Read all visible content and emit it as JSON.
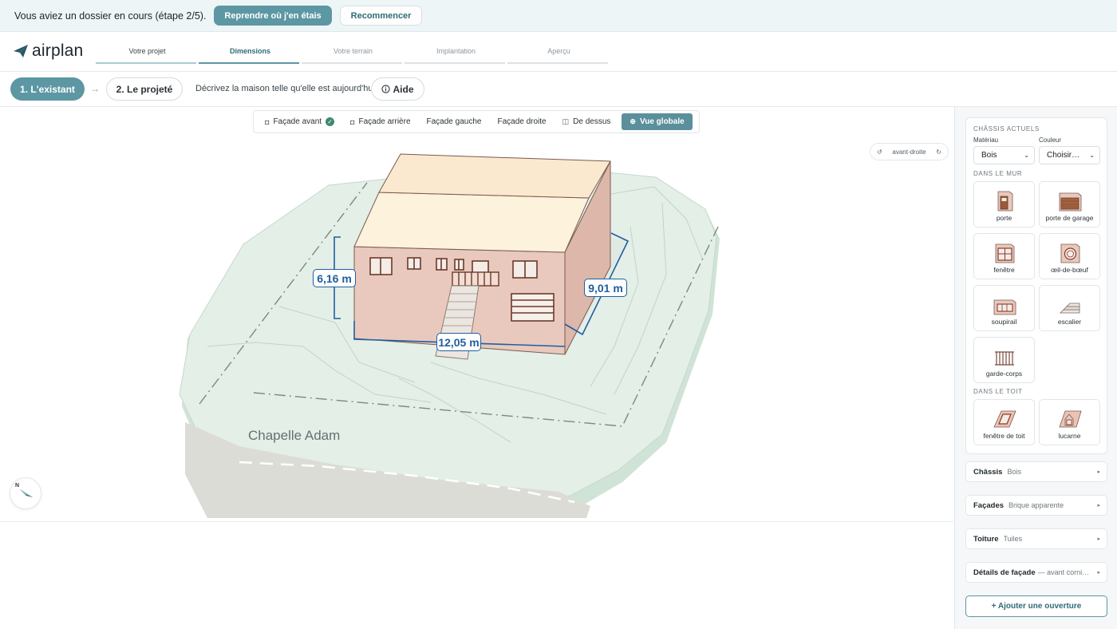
{
  "banner": {
    "text": "Vous aviez un dossier en cours (étape 2/5).",
    "resume_label": "Reprendre où j'en étais",
    "restart_label": "Recommencer"
  },
  "header": {
    "logo": "airplan",
    "steps": [
      {
        "label": "Votre projet",
        "state": "done"
      },
      {
        "label": "Dimensions",
        "state": "active"
      },
      {
        "label": "Votre terrain",
        "state": "todo"
      },
      {
        "label": "Implantation",
        "state": "todo"
      },
      {
        "label": "Aperçu",
        "state": "todo"
      }
    ]
  },
  "subbar": {
    "existing_label": "1. L'existant",
    "arrow": "→",
    "projected_label": "2. Le projeté",
    "description": "Décrivez la maison telle qu'elle est aujourd'hui.",
    "help_label": "Aide"
  },
  "viewer": {
    "tabs": [
      {
        "label": "Façade avant",
        "icon": "camera-icon",
        "checked": true
      },
      {
        "label": "Façade arrière",
        "icon": "camera-icon"
      },
      {
        "label": "Façade gauche"
      },
      {
        "label": "Façade droite"
      },
      {
        "label": "De dessus",
        "icon": "plan-icon"
      },
      {
        "label": "Vue globale",
        "icon": "globe-icon",
        "selected": true
      }
    ],
    "rotation_label": "avant-droite",
    "dim_height": "6,16 m",
    "dim_depth": "9,01 m",
    "dim_width": "12,05 m",
    "street_name": "Chapelle Adam",
    "compass_label": "N"
  },
  "panel": {
    "current_frames_title": "Châssis actuels",
    "material_label": "Matériau",
    "material_value": "Bois",
    "color_label": "Couleur",
    "color_value": "Choisir…",
    "in_wall_title": "Dans le mur",
    "wall_items": [
      "porte",
      "porte de garage",
      "fenêtre",
      "œil-de-bœuf",
      "soupirail",
      "escalier",
      "garde-corps"
    ],
    "in_roof_title": "Dans le toit",
    "roof_items": [
      "fenêtre de toit",
      "lucarne"
    ],
    "accordions": [
      {
        "key": "Châssis",
        "value": "Bois"
      },
      {
        "key": "Façades",
        "value": "Brique apparente"
      },
      {
        "key": "Toiture",
        "value": "Tuiles"
      },
      {
        "key": "Détails de façade",
        "value": "— avant   corni…"
      }
    ],
    "add_opening_label": "+ Ajouter une ouverture"
  },
  "colors": {
    "accent": "#5c97a3",
    "terrain": "#e3efe7",
    "wall": "#e9c9bd",
    "roof": "#fdf2dc",
    "dimension": "#1f5fa0"
  }
}
